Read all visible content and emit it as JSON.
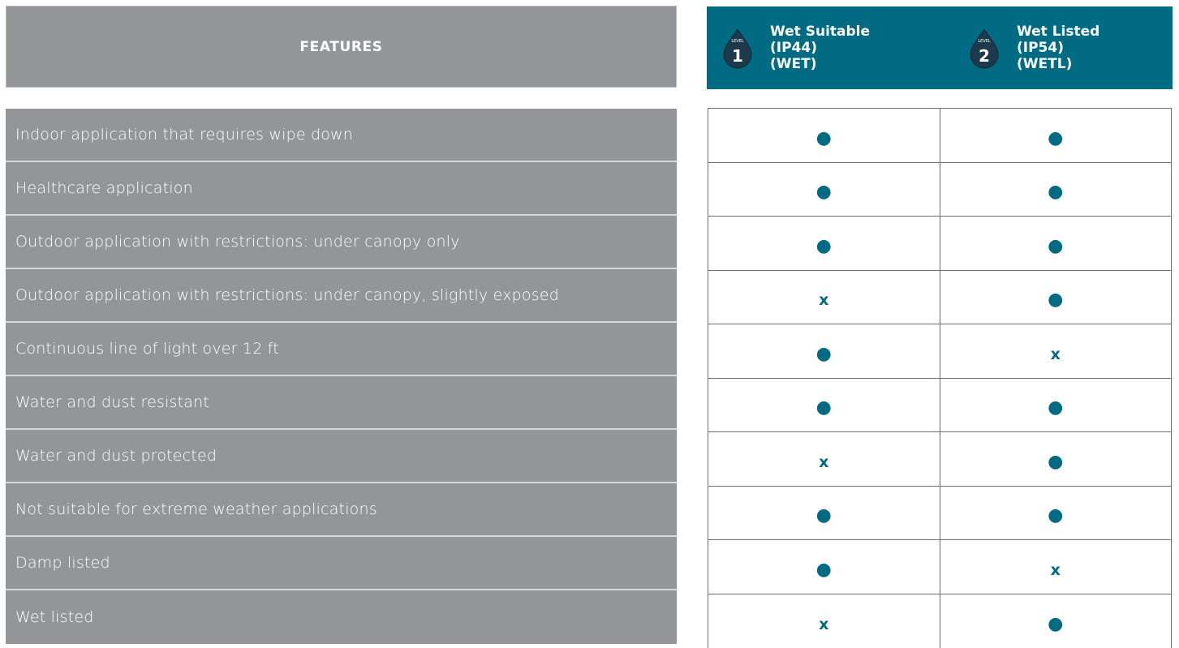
{
  "header": {
    "features_label": "FEATURES",
    "levels": [
      {
        "icon": "drop-level-1-icon",
        "level_word": "LEVEL",
        "number": "1",
        "title": "Wet Suitable",
        "ip": "(IP44)",
        "code": "(WET)"
      },
      {
        "icon": "drop-level-2-icon",
        "level_word": "LEVEL",
        "number": "2",
        "title": "Wet Listed",
        "ip": "(IP54)",
        "code": "(WETL)"
      }
    ]
  },
  "marks": {
    "yes": "●",
    "no": "x"
  },
  "rows": [
    {
      "feature": "Indoor application that requires wipe down",
      "level1": "●",
      "level2": "●"
    },
    {
      "feature": "Healthcare application",
      "level1": "●",
      "level2": "●"
    },
    {
      "feature": "Outdoor application with restrictions: under canopy only",
      "level1": "●",
      "level2": "●"
    },
    {
      "feature": "Outdoor application with restrictions: under canopy, slightly exposed",
      "level1": "x",
      "level2": "●"
    },
    {
      "feature": "Continuous line of light over 12 ft",
      "level1": "●",
      "level2": "x"
    },
    {
      "feature": "Water and dust resistant",
      "level1": "●",
      "level2": "●"
    },
    {
      "feature": "Water and dust protected",
      "level1": "x",
      "level2": "●"
    },
    {
      "feature": "Not suitable for extreme weather applications",
      "level1": "●",
      "level2": "●"
    },
    {
      "feature": "Damp listed",
      "level1": "●",
      "level2": "x"
    },
    {
      "feature": "Wet listed",
      "level1": "x",
      "level2": "●"
    }
  ],
  "colors": {
    "header_teal": "#006b82",
    "feature_gray": "#939598",
    "mark_teal": "#006b82"
  }
}
